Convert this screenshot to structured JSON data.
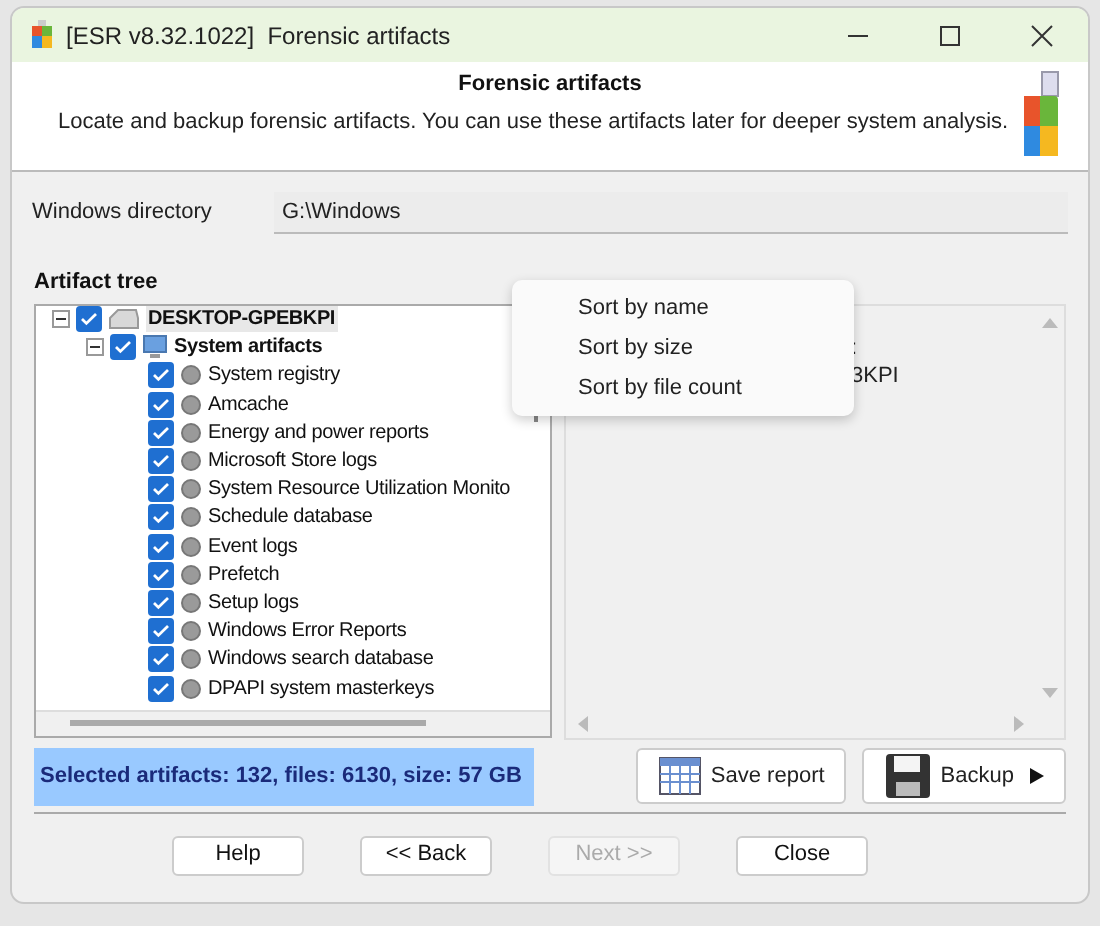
{
  "window": {
    "title": "[ESR v8.32.1022]  Forensic artifacts"
  },
  "header": {
    "title": "Forensic artifacts",
    "description": "Locate and backup forensic artifacts. You can use these artifacts later for deeper system analysis."
  },
  "windows_directory": {
    "label": "Windows directory",
    "value": "G:\\Windows"
  },
  "artifact_tree": {
    "label": "Artifact tree",
    "items": [
      {
        "label": "DESKTOP-GPEBKPI",
        "kind": "computer",
        "checked": true,
        "expanded": true,
        "selected": true,
        "children": [
          {
            "label": "System artifacts",
            "kind": "group",
            "checked": true,
            "expanded": true,
            "selected": false,
            "children": [
              {
                "label": "System registry",
                "kind": "artifact",
                "checked": true,
                "selected": false
              },
              {
                "label": "Amcache",
                "kind": "artifact",
                "checked": true,
                "selected": false
              },
              {
                "label": "Energy and power reports",
                "kind": "artifact",
                "checked": true,
                "selected": false
              },
              {
                "label": "Microsoft Store logs",
                "kind": "artifact",
                "checked": true,
                "selected": false
              },
              {
                "label": "System Resource Utilization Monito",
                "kind": "artifact",
                "checked": true,
                "selected": false
              },
              {
                "label": "Schedule database",
                "kind": "artifact",
                "checked": true,
                "selected": false
              },
              {
                "label": "Event logs",
                "kind": "artifact",
                "checked": true,
                "selected": false
              },
              {
                "label": "Prefetch",
                "kind": "artifact",
                "checked": true,
                "selected": false
              },
              {
                "label": "Setup logs",
                "kind": "artifact",
                "checked": true,
                "selected": false
              },
              {
                "label": "Windows Error Reports",
                "kind": "artifact",
                "checked": true,
                "selected": false
              },
              {
                "label": "Windows search database",
                "kind": "artifact",
                "checked": true,
                "selected": false
              },
              {
                "label": "DPAPI system masterkeys",
                "kind": "artifact",
                "checked": true,
                "selected": false
              }
            ]
          }
        ]
      }
    ]
  },
  "details": {
    "lines": [
      ":",
      "3KPI"
    ]
  },
  "status": "Selected artifacts: 132, files: 6130, size: 57 GB",
  "actions": [
    {
      "label": "Save report",
      "kind": "report"
    },
    {
      "label": "Backup",
      "kind": "backup"
    }
  ],
  "context_menu": [
    "Sort by name",
    "Sort by size",
    "Sort by file count"
  ],
  "buttons": [
    {
      "label": "Help",
      "disabled": false
    },
    {
      "label": "<< Back",
      "disabled": false
    },
    {
      "label": "Next >>",
      "disabled": true
    },
    {
      "label": "Close",
      "disabled": false
    }
  ]
}
